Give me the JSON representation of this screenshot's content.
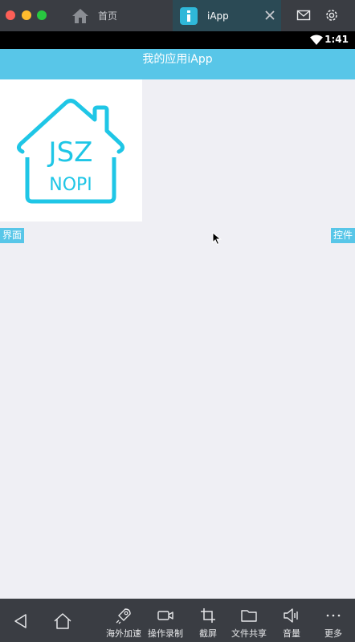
{
  "tabs": {
    "home_label": "首页",
    "app_label": "iApp"
  },
  "status": {
    "time": "1:41"
  },
  "app": {
    "title": "我的应用iApp",
    "logo_text": [
      "JSZ",
      "NOPI"
    ],
    "left_chip": "界面",
    "right_chip": "控件"
  },
  "toolbar": {
    "items": [
      {
        "label": "海外加速",
        "icon": "rocket-icon"
      },
      {
        "label": "操作录制",
        "icon": "video-camera-icon"
      },
      {
        "label": "截屏",
        "icon": "crop-icon"
      },
      {
        "label": "文件共享",
        "icon": "folder-icon"
      },
      {
        "label": "音量",
        "icon": "speaker-icon"
      },
      {
        "label": "更多",
        "icon": "more-icon"
      }
    ]
  },
  "colors": {
    "accent": "#58c6e8",
    "logo": "#1fc6e6",
    "chrome": "#3a3d43",
    "background": "#efeff4"
  }
}
